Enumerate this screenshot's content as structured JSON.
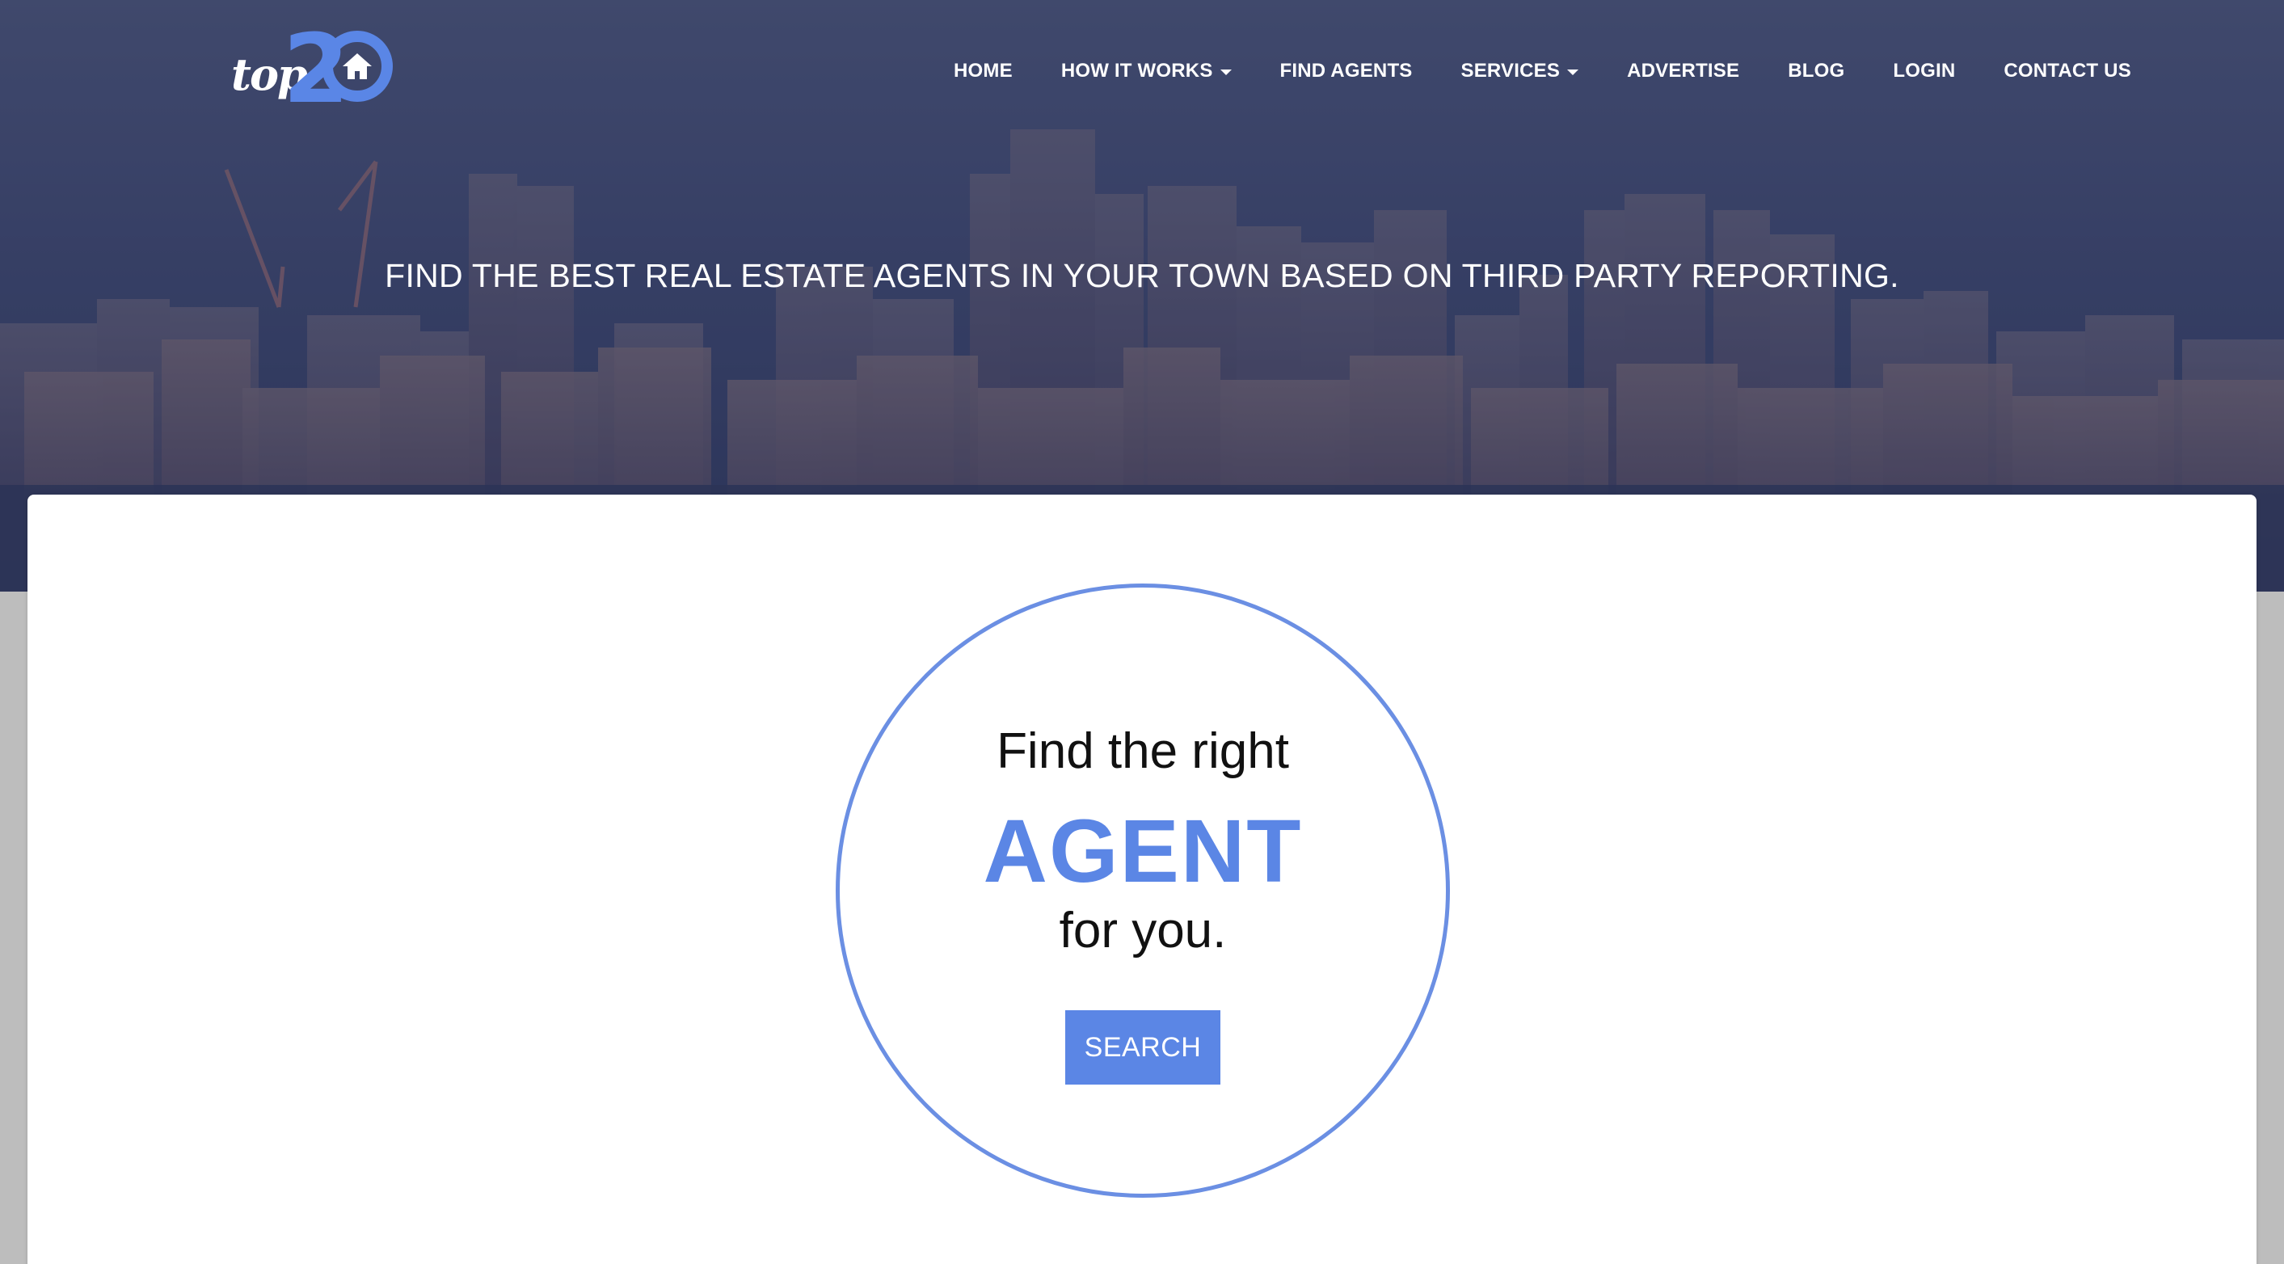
{
  "brand": {
    "logo_word": "top",
    "logo_number": "2",
    "accent_color": "#5b86e5"
  },
  "nav": {
    "items": [
      {
        "label": "HOME",
        "has_dropdown": false
      },
      {
        "label": "HOW IT WORKS",
        "has_dropdown": true
      },
      {
        "label": "FIND AGENTS",
        "has_dropdown": false
      },
      {
        "label": "SERVICES",
        "has_dropdown": true
      },
      {
        "label": "ADVERTISE",
        "has_dropdown": false
      },
      {
        "label": "BLOG",
        "has_dropdown": false
      },
      {
        "label": "LOGIN",
        "has_dropdown": false
      },
      {
        "label": "CONTACT US",
        "has_dropdown": false
      }
    ]
  },
  "hero": {
    "tagline": "FIND THE BEST REAL ESTATE AGENTS IN YOUR TOWN BASED ON THIRD PARTY REPORTING."
  },
  "promo": {
    "line1": "Find the right",
    "line2": "AGENT",
    "line3": "for you.",
    "button_label": "SEARCH"
  },
  "icons": {
    "logo_house": "house-icon",
    "dropdown": "caret-down-icon"
  }
}
